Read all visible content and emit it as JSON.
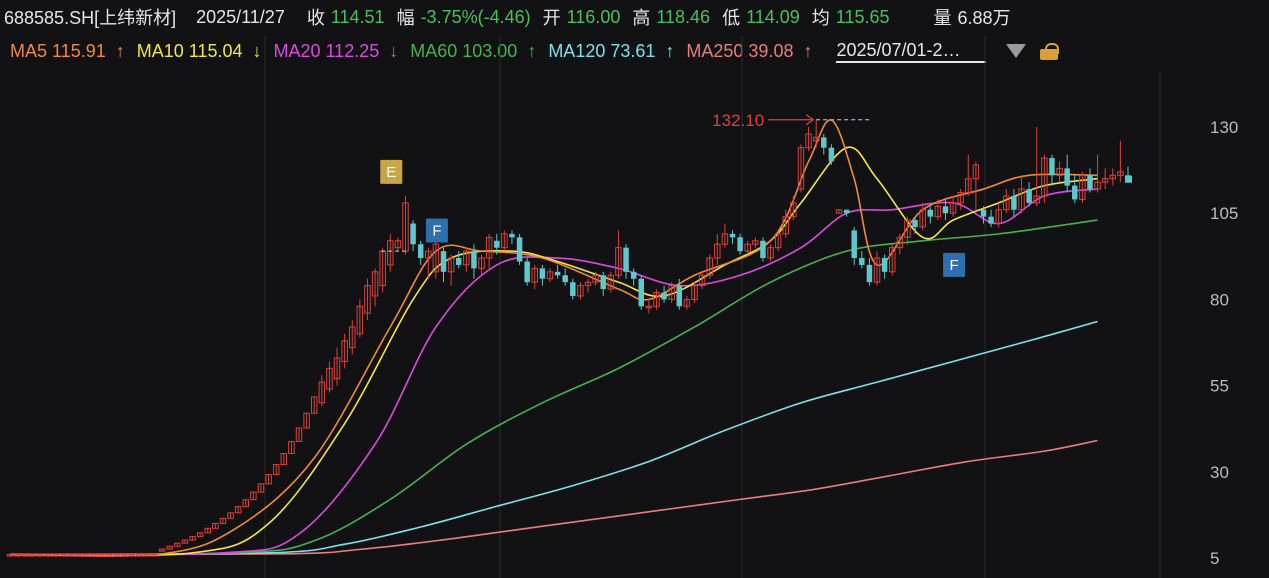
{
  "header": {
    "symbol": "688585.SH[上纬新材]",
    "date": "2025/11/27",
    "close_label": "收",
    "close": "114.51",
    "change_label": "幅",
    "change": "-3.75%(-4.46)",
    "open_label": "开",
    "open": "116.00",
    "high_label": "高",
    "high": "118.46",
    "low_label": "低",
    "low": "114.09",
    "avg_label": "均",
    "avg": "115.65",
    "volume_label": "量",
    "volume": "6.88万"
  },
  "ma_legend": [
    {
      "label": "MA5 115.91",
      "arrow": "↑",
      "color": "#f08a3c"
    },
    {
      "label": "MA10 115.04",
      "arrow": "↓",
      "color": "#f3e64a"
    },
    {
      "label": "MA20 112.25",
      "arrow": "↓",
      "color": "#d94be0"
    },
    {
      "label": "MA60 103.00",
      "arrow": "↑",
      "color": "#46b24d"
    },
    {
      "label": "MA120 73.61",
      "arrow": "↑",
      "color": "#7fe0ee"
    },
    {
      "label": "MA250 39.08",
      "arrow": "↑",
      "color": "#e87f78"
    }
  ],
  "date_range": "2025/07/01-2…",
  "colors": {
    "up": "#e0403a",
    "down": "#5ec8cc",
    "background": "#121214",
    "grid": "#2a2a2e",
    "axis_text": "#bdbdbd",
    "header_value": "#46c25a"
  },
  "chart_data": {
    "type": "candlestick",
    "y_ticks": [
      130,
      105,
      80,
      55,
      30,
      5
    ],
    "ylim": [
      2,
      140
    ],
    "annotations": [
      {
        "text": "132.10",
        "type": "max_marker"
      },
      {
        "text": "E",
        "type": "event_badge",
        "color": "#c9a54a"
      },
      {
        "text": "F",
        "type": "event_badge",
        "color": "#2f6fb0"
      },
      {
        "text": "F",
        "type": "event_badge",
        "color": "#2f6fb0"
      }
    ],
    "candles": [
      [
        6,
        6,
        6,
        6
      ],
      [
        6,
        6,
        6,
        6
      ],
      [
        6,
        6,
        6,
        6
      ],
      [
        6,
        6,
        6,
        6
      ],
      [
        6,
        6,
        6,
        6
      ],
      [
        6,
        6,
        6,
        6
      ],
      [
        6,
        6,
        6,
        6
      ],
      [
        6,
        6,
        6,
        6
      ],
      [
        6,
        6,
        6,
        6
      ],
      [
        6,
        6,
        6,
        6
      ],
      [
        6,
        6,
        6,
        6
      ],
      [
        6,
        6,
        6,
        6
      ],
      [
        6,
        6,
        6,
        6
      ],
      [
        6,
        6,
        6,
        6
      ],
      [
        6,
        6,
        6,
        6
      ],
      [
        6,
        6,
        6,
        6
      ],
      [
        6,
        6,
        6,
        6
      ],
      [
        6,
        6,
        6,
        6
      ],
      [
        6,
        6,
        6,
        6
      ],
      [
        6,
        6,
        6,
        6
      ],
      [
        7,
        7.6,
        7.6,
        7
      ],
      [
        7.6,
        8.4,
        8.4,
        7.6
      ],
      [
        8.4,
        9.3,
        9.3,
        8.4
      ],
      [
        9.3,
        10.2,
        10.2,
        9.3
      ],
      [
        10.2,
        11.2,
        11.2,
        10.2
      ],
      [
        11.2,
        12.3,
        12.3,
        11.2
      ],
      [
        12.3,
        13.6,
        13.6,
        12.3
      ],
      [
        13.6,
        15,
        15,
        13.6
      ],
      [
        15,
        16.5,
        16.5,
        15
      ],
      [
        16.5,
        18.1,
        18.1,
        16.5
      ],
      [
        18.1,
        19.9,
        19.9,
        18.1
      ],
      [
        19.9,
        21.9,
        21.9,
        19.9
      ],
      [
        21.9,
        24.1,
        24.1,
        21.9
      ],
      [
        24.1,
        26.5,
        26.5,
        24.1
      ],
      [
        26.5,
        29.2,
        29.2,
        26.5
      ],
      [
        29.2,
        32.1,
        32.1,
        29.2
      ],
      [
        32.1,
        35.3,
        35.3,
        32.1
      ],
      [
        35.3,
        38.8,
        38.8,
        35.3
      ],
      [
        38.8,
        42.7,
        42.7,
        38.8
      ],
      [
        42.7,
        47,
        47,
        42.7
      ],
      [
        47,
        51.7,
        51.7,
        47
      ],
      [
        50,
        56,
        58,
        49
      ],
      [
        54,
        60,
        62,
        53
      ],
      [
        57,
        63,
        66,
        55
      ],
      [
        62,
        68,
        70,
        60
      ],
      [
        66,
        72,
        74,
        64
      ],
      [
        70,
        78,
        80,
        69
      ],
      [
        76,
        84,
        86,
        74
      ],
      [
        81,
        88,
        89,
        78
      ],
      [
        84,
        94,
        95,
        82
      ],
      [
        90,
        97,
        99,
        88
      ],
      [
        95,
        97,
        98,
        94
      ],
      [
        94,
        108,
        110,
        93
      ],
      [
        102,
        96,
        103,
        94
      ],
      [
        96,
        92,
        97,
        90
      ],
      [
        92,
        94,
        95,
        86
      ],
      [
        88,
        96,
        97,
        86
      ],
      [
        94,
        88,
        95,
        85
      ],
      [
        88,
        92,
        93,
        84
      ],
      [
        92,
        90,
        94,
        89
      ],
      [
        90,
        94,
        95,
        88
      ],
      [
        94,
        89,
        96,
        86
      ],
      [
        89,
        92,
        93,
        87
      ],
      [
        92,
        98,
        99,
        89
      ],
      [
        97,
        95,
        99,
        93
      ],
      [
        95,
        99,
        100,
        94
      ],
      [
        99,
        98,
        100,
        96
      ],
      [
        98,
        91,
        99,
        90
      ],
      [
        91,
        85,
        92,
        84
      ],
      [
        85,
        89,
        90,
        83
      ],
      [
        89,
        86,
        90,
        84
      ],
      [
        86,
        88,
        89,
        85
      ],
      [
        88,
        87,
        90,
        86
      ],
      [
        87,
        85,
        89,
        84
      ],
      [
        85,
        81,
        86,
        80
      ],
      [
        81,
        84,
        85,
        80
      ],
      [
        84,
        85,
        86,
        82
      ],
      [
        85,
        87,
        88,
        84
      ],
      [
        87,
        83,
        88,
        81
      ],
      [
        83,
        87,
        88,
        82
      ],
      [
        87,
        95,
        100,
        86
      ],
      [
        95,
        88,
        96,
        86
      ],
      [
        88,
        86,
        89,
        84
      ],
      [
        86,
        78,
        87,
        77
      ],
      [
        78,
        78,
        80,
        76
      ],
      [
        78,
        82,
        83,
        77
      ],
      [
        82,
        80,
        84,
        79
      ],
      [
        80,
        84,
        85,
        79
      ],
      [
        84,
        78,
        86,
        77
      ],
      [
        78,
        80,
        81,
        77
      ],
      [
        80,
        84,
        85,
        79
      ],
      [
        84,
        87,
        88,
        83
      ],
      [
        87,
        92,
        93,
        86
      ],
      [
        92,
        96,
        99,
        90
      ],
      [
        96,
        99,
        102,
        95
      ],
      [
        99,
        98,
        100,
        96
      ],
      [
        98,
        94,
        99,
        93
      ],
      [
        94,
        96,
        97,
        93
      ],
      [
        96,
        97,
        98,
        95
      ],
      [
        97,
        92,
        98,
        91
      ],
      [
        92,
        95,
        96,
        91
      ],
      [
        95,
        99,
        100,
        94
      ],
      [
        99,
        104,
        106,
        98
      ],
      [
        104,
        108,
        110,
        103
      ],
      [
        112,
        124,
        125,
        111
      ],
      [
        124,
        128,
        130,
        123
      ],
      [
        126,
        127,
        132.1,
        124
      ],
      [
        127,
        124,
        128,
        122
      ],
      [
        124,
        120,
        125,
        119
      ],
      [
        105,
        106,
        106,
        105
      ],
      [
        106,
        105,
        106,
        104
      ],
      [
        100,
        92,
        101,
        90
      ],
      [
        92,
        90,
        94,
        89
      ],
      [
        90,
        85,
        92,
        84
      ],
      [
        85,
        92,
        94,
        84
      ],
      [
        92,
        88,
        93,
        86
      ],
      [
        88,
        95,
        96,
        87
      ],
      [
        95,
        98,
        99,
        93
      ],
      [
        98,
        103,
        104,
        96
      ],
      [
        103,
        101,
        104,
        99
      ],
      [
        101,
        106,
        108,
        100
      ],
      [
        106,
        104,
        107,
        102
      ],
      [
        104,
        107,
        109,
        103
      ],
      [
        107,
        105,
        109,
        103
      ],
      [
        105,
        108,
        110,
        104
      ],
      [
        108,
        111,
        112,
        106
      ],
      [
        111,
        115,
        122,
        110
      ],
      [
        115,
        119,
        120,
        106
      ],
      [
        106,
        104,
        107,
        102
      ],
      [
        104,
        102,
        106,
        101
      ],
      [
        102,
        106,
        108,
        101
      ],
      [
        106,
        110,
        112,
        105
      ],
      [
        110,
        106,
        112,
        104
      ],
      [
        106,
        112,
        116,
        105
      ],
      [
        112,
        108,
        114,
        107
      ],
      [
        108,
        110,
        130,
        107
      ],
      [
        110,
        121,
        122,
        108
      ],
      [
        121,
        116,
        122,
        113
      ],
      [
        116,
        118,
        120,
        114
      ],
      [
        118,
        113,
        122,
        111
      ],
      [
        113,
        109,
        116,
        108
      ],
      [
        109,
        116,
        117,
        108
      ],
      [
        116,
        112,
        118,
        111
      ],
      [
        112,
        114,
        122,
        111
      ],
      [
        114,
        115,
        118,
        112
      ],
      [
        115,
        116,
        118,
        113
      ],
      [
        116,
        117,
        126,
        114
      ],
      [
        116,
        114.51,
        118.46,
        114.09
      ]
    ],
    "ma5": [
      [
        0,
        6
      ],
      [
        20,
        6.2
      ],
      [
        30,
        14
      ],
      [
        40,
        34
      ],
      [
        50,
        72
      ],
      [
        56,
        94
      ],
      [
        62,
        94
      ],
      [
        70,
        92
      ],
      [
        80,
        83
      ],
      [
        84,
        80
      ],
      [
        90,
        87
      ],
      [
        100,
        97
      ],
      [
        105,
        120
      ],
      [
        108,
        132
      ],
      [
        111,
        115
      ],
      [
        114,
        90
      ],
      [
        120,
        106
      ],
      [
        128,
        112
      ],
      [
        134,
        116
      ],
      [
        143,
        116
      ]
    ],
    "ma10": [
      [
        0,
        6
      ],
      [
        24,
        6.5
      ],
      [
        34,
        15
      ],
      [
        44,
        44
      ],
      [
        53,
        80
      ],
      [
        58,
        92
      ],
      [
        66,
        94
      ],
      [
        72,
        91
      ],
      [
        80,
        85
      ],
      [
        86,
        81
      ],
      [
        94,
        90
      ],
      [
        100,
        97
      ],
      [
        104,
        108
      ],
      [
        110,
        124
      ],
      [
        114,
        115
      ],
      [
        120,
        98
      ],
      [
        124,
        103
      ],
      [
        130,
        108
      ],
      [
        136,
        113
      ],
      [
        143,
        115
      ]
    ],
    "ma20": [
      [
        0,
        6
      ],
      [
        28,
        6.5
      ],
      [
        38,
        12
      ],
      [
        48,
        38
      ],
      [
        56,
        72
      ],
      [
        64,
        90
      ],
      [
        72,
        92
      ],
      [
        80,
        89
      ],
      [
        88,
        84
      ],
      [
        96,
        87
      ],
      [
        104,
        95
      ],
      [
        110,
        105
      ],
      [
        116,
        106
      ],
      [
        124,
        108
      ],
      [
        130,
        102
      ],
      [
        136,
        110
      ],
      [
        143,
        112
      ]
    ],
    "ma60": [
      [
        0,
        6
      ],
      [
        30,
        6.5
      ],
      [
        40,
        10
      ],
      [
        50,
        22
      ],
      [
        60,
        38
      ],
      [
        70,
        50
      ],
      [
        80,
        60
      ],
      [
        90,
        72
      ],
      [
        100,
        85
      ],
      [
        110,
        94
      ],
      [
        120,
        97
      ],
      [
        130,
        99
      ],
      [
        143,
        103
      ]
    ],
    "ma120": [
      [
        0,
        6
      ],
      [
        34,
        6.5
      ],
      [
        44,
        9
      ],
      [
        54,
        14
      ],
      [
        64,
        20
      ],
      [
        74,
        26
      ],
      [
        84,
        33
      ],
      [
        94,
        42
      ],
      [
        104,
        50
      ],
      [
        114,
        56
      ],
      [
        124,
        62
      ],
      [
        134,
        68
      ],
      [
        143,
        73.6
      ]
    ],
    "ma250": [
      [
        0,
        6
      ],
      [
        36,
        6.2
      ],
      [
        46,
        7.5
      ],
      [
        56,
        10
      ],
      [
        66,
        13
      ],
      [
        76,
        16
      ],
      [
        86,
        19
      ],
      [
        96,
        22
      ],
      [
        106,
        25
      ],
      [
        116,
        29
      ],
      [
        126,
        33
      ],
      [
        136,
        36
      ],
      [
        143,
        39.08
      ]
    ]
  }
}
